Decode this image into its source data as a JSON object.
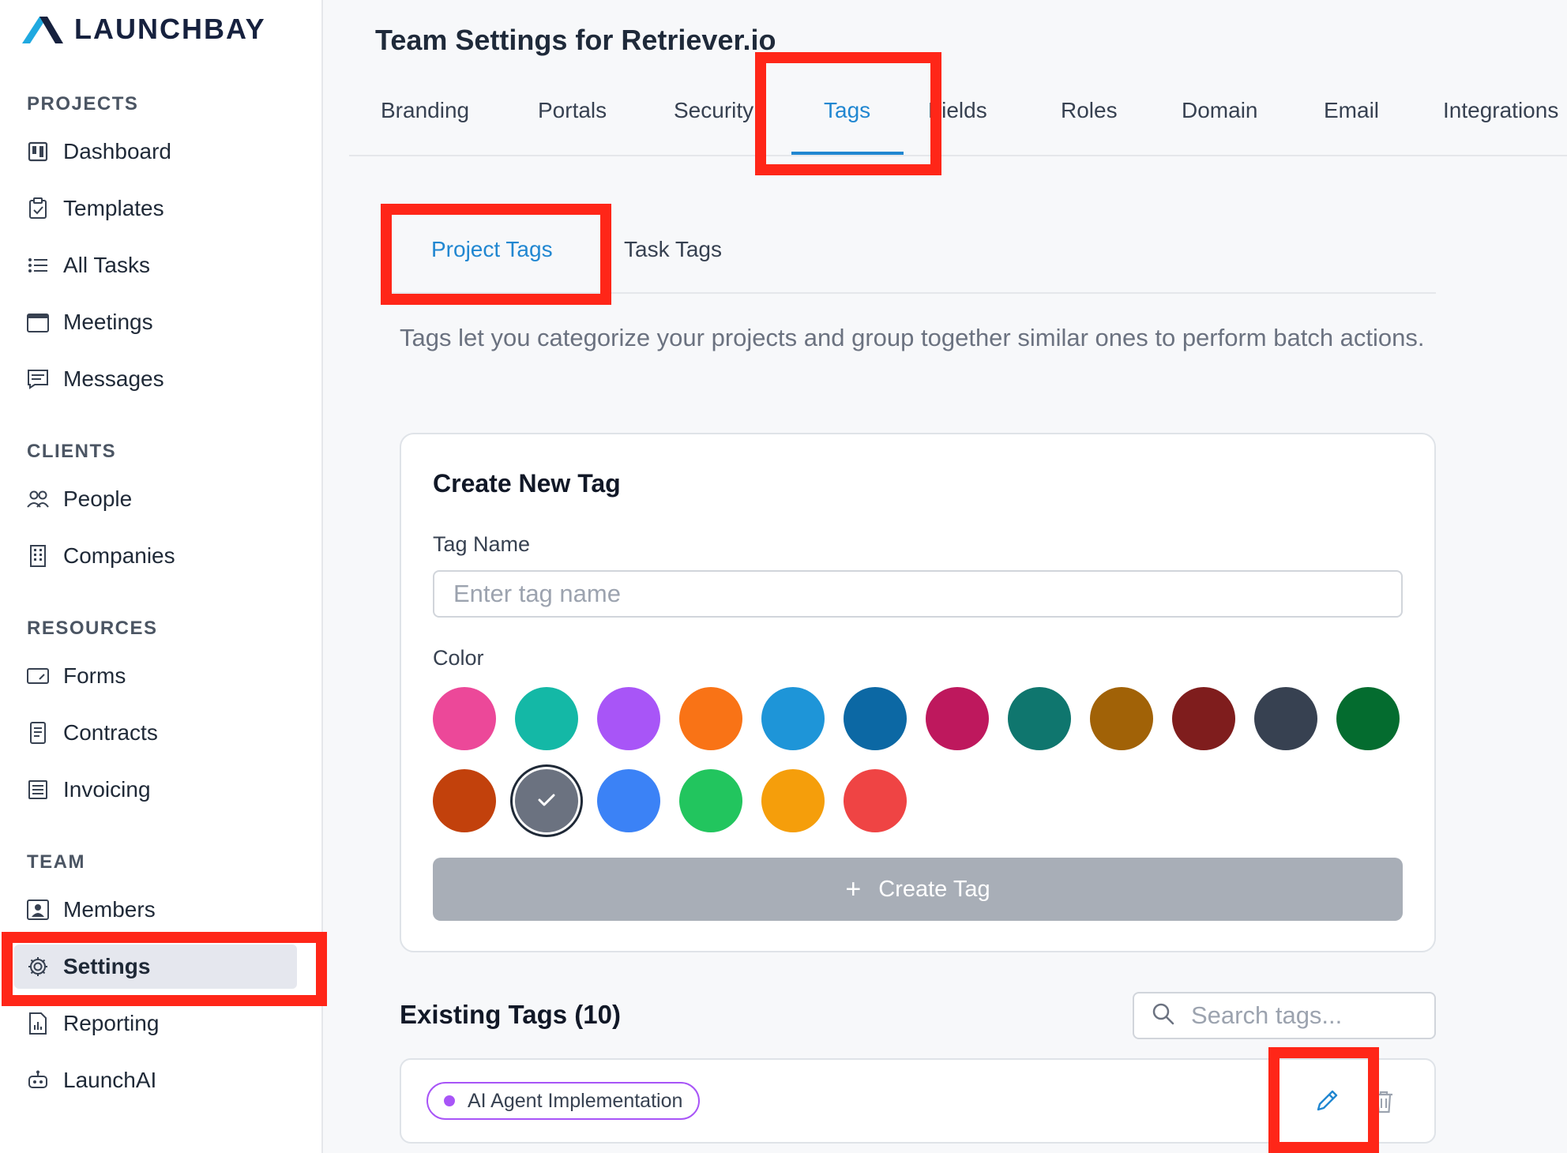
{
  "brand": {
    "name": "LAUNCHBAY",
    "accent": "#1fa9e0"
  },
  "sidebar": {
    "sections": {
      "projects": "PROJECTS",
      "clients": "CLIENTS",
      "resources": "RESOURCES",
      "team": "TEAM"
    },
    "items": [
      {
        "label": "Dashboard",
        "icon": "dashboard-icon"
      },
      {
        "label": "Templates",
        "icon": "clipboard-icon"
      },
      {
        "label": "All Tasks",
        "icon": "list-icon"
      },
      {
        "label": "Meetings",
        "icon": "calendar-icon"
      },
      {
        "label": "Messages",
        "icon": "message-icon"
      },
      {
        "label": "People",
        "icon": "people-icon"
      },
      {
        "label": "Companies",
        "icon": "building-icon"
      },
      {
        "label": "Forms",
        "icon": "form-icon"
      },
      {
        "label": "Contracts",
        "icon": "document-icon"
      },
      {
        "label": "Invoicing",
        "icon": "invoice-icon"
      },
      {
        "label": "Members",
        "icon": "member-icon"
      },
      {
        "label": "Settings",
        "icon": "gear-icon",
        "active": true
      },
      {
        "label": "Reporting",
        "icon": "chart-icon"
      },
      {
        "label": "LaunchAI",
        "icon": "robot-icon"
      }
    ]
  },
  "header": {
    "title": "Team Settings for Retriever.io",
    "tabs": [
      "Branding",
      "Portals",
      "Security",
      "Tags",
      "Fields",
      "Roles",
      "Domain",
      "Email",
      "Integrations"
    ],
    "active_tab": "Tags"
  },
  "subtabs": {
    "items": [
      "Project Tags",
      "Task Tags"
    ],
    "active": "Project Tags"
  },
  "description": "Tags let you categorize your projects and group together similar ones to perform batch actions.",
  "create_tag": {
    "title": "Create New Tag",
    "name_label": "Tag Name",
    "name_placeholder": "Enter tag name",
    "name_value": "",
    "color_label": "Color",
    "colors": [
      "#ec4899",
      "#14b8a6",
      "#a855f7",
      "#f97316",
      "#1e95d8",
      "#0c68a4",
      "#be185d",
      "#0f766e",
      "#a16207",
      "#7f1d1d",
      "#374151",
      "#046c2f",
      "#c2410c",
      "#6b7280",
      "#3b82f6",
      "#22c55e",
      "#f59e0b",
      "#ef4444"
    ],
    "selected_color": "#6b7280",
    "button_label": "Create Tag"
  },
  "existing_tags": {
    "title": "Existing Tags (10)",
    "search_placeholder": "Search tags...",
    "items": [
      {
        "label": "AI Agent Implementation",
        "color": "#a855f7"
      }
    ]
  }
}
